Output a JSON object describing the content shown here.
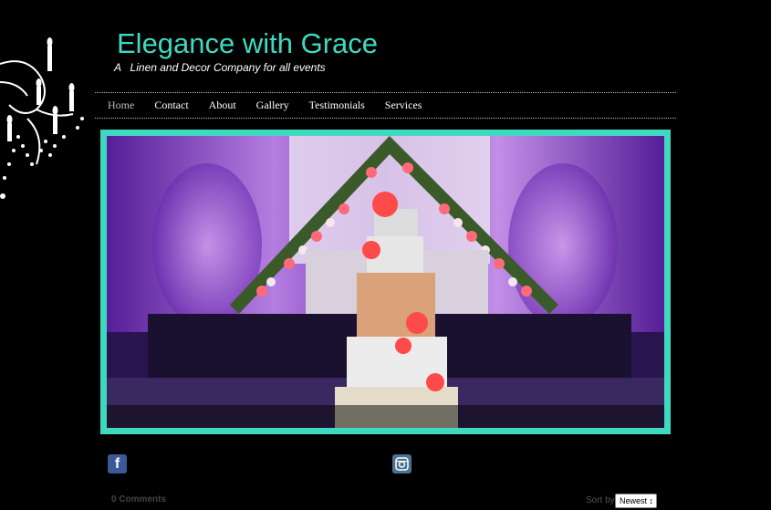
{
  "site": {
    "title": "Elegance with Grace",
    "tagline": "A   Linen and Decor Company for all events"
  },
  "nav": {
    "items": [
      {
        "label": "Home",
        "active": true
      },
      {
        "label": "Contact"
      },
      {
        "label": "About"
      },
      {
        "label": "Gallery"
      },
      {
        "label": "Testimonials"
      },
      {
        "label": "Services"
      }
    ]
  },
  "hero": {
    "alt": "Wedding cake in front of purple-lit stage with floral arch"
  },
  "social": {
    "facebook_glyph": "f"
  },
  "comments": {
    "count_label": "0 Comments",
    "sort_label": "Sort by",
    "sort_value": "Newest ↕"
  },
  "colors": {
    "accent": "#3fd9c0",
    "background": "#000000"
  }
}
